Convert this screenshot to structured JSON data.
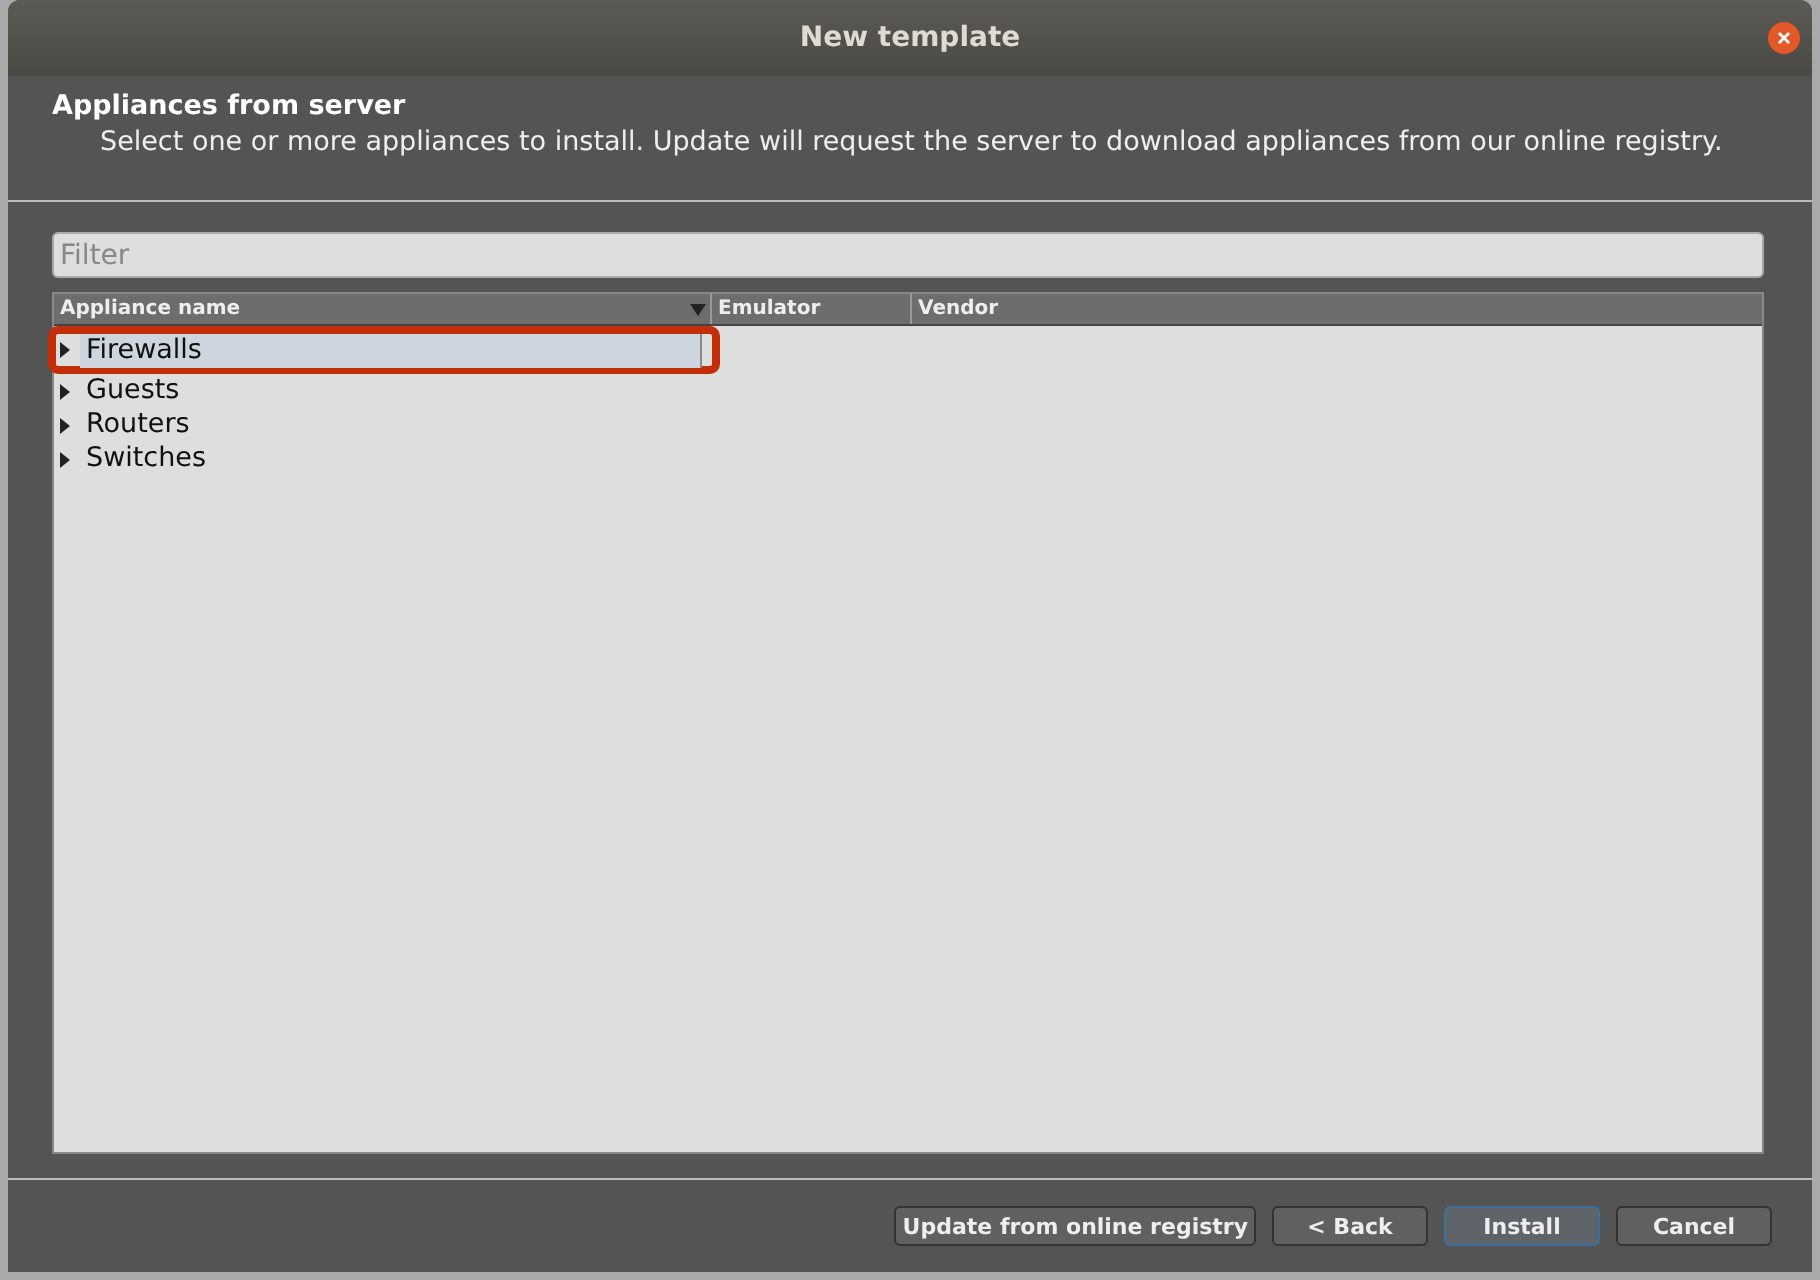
{
  "window": {
    "title": "New template"
  },
  "header": {
    "title": "Appliances from server",
    "subtitle": "Select one or more appliances to install. Update will request the server to download appliances from our online registry."
  },
  "filter": {
    "placeholder": "Filter"
  },
  "table": {
    "columns": [
      "Appliance name",
      "Emulator",
      "Vendor"
    ],
    "rows": [
      {
        "label": "Firewalls",
        "selected": true,
        "expanded": false,
        "outlined": true
      },
      {
        "label": "Guests",
        "selected": false,
        "expanded": false,
        "outlined": false
      },
      {
        "label": "Routers",
        "selected": false,
        "expanded": false,
        "outlined": false
      },
      {
        "label": "Switches",
        "selected": false,
        "expanded": false,
        "outlined": false
      }
    ]
  },
  "buttons": [
    {
      "label": "Update from online registry",
      "kind": "plain"
    },
    {
      "label": "< Back",
      "kind": "plain"
    },
    {
      "label": "Install",
      "kind": "default"
    },
    {
      "label": "Cancel",
      "kind": "plain"
    }
  ]
}
